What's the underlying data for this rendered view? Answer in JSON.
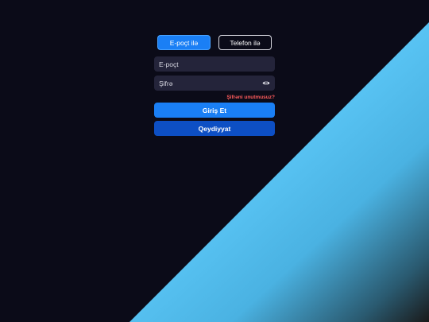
{
  "tabs": {
    "email_label": "E-poçt ilə",
    "phone_label": "Telefon ilə"
  },
  "fields": {
    "email_placeholder": "E-poçt",
    "password_placeholder": "Şifrə"
  },
  "links": {
    "forgot_password": "Şifrəni unutmusuz?"
  },
  "buttons": {
    "login": "Giriş Et",
    "register": "Qeydiyyat"
  },
  "icons": {
    "password_visibility": "eye-icon"
  },
  "colors": {
    "background": "#0b0b18",
    "accent": "#1a7ff5",
    "register": "#0d4fc4",
    "forgot_link": "#ff5c5c",
    "gradient_light": "#5cc8f8",
    "gradient_dark": "#1a1a1a"
  }
}
